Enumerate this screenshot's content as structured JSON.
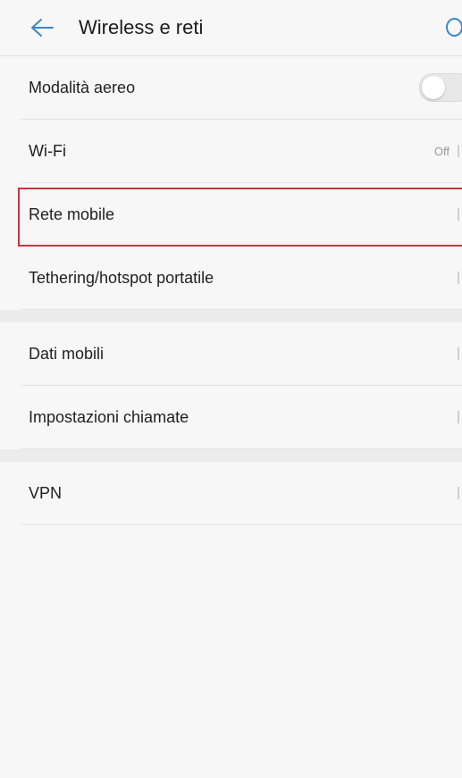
{
  "header": {
    "title": "Wireless e reti",
    "back_icon": "arrow-left-icon",
    "search_icon": "search-icon"
  },
  "sections": [
    {
      "items": [
        {
          "label": "Modalità aereo",
          "control": "toggle",
          "toggle_on": false
        },
        {
          "label": "Wi-Fi",
          "value": "Off"
        },
        {
          "label": "Rete mobile",
          "highlighted": true
        },
        {
          "label": "Tethering/hotspot portatile"
        }
      ]
    },
    {
      "items": [
        {
          "label": "Dati mobili"
        },
        {
          "label": "Impostazioni chiamate"
        }
      ]
    },
    {
      "items": [
        {
          "label": "VPN"
        }
      ]
    }
  ],
  "colors": {
    "accent": "#3a86c8",
    "highlight_border": "#c9343f",
    "background": "#f7f7f7"
  }
}
